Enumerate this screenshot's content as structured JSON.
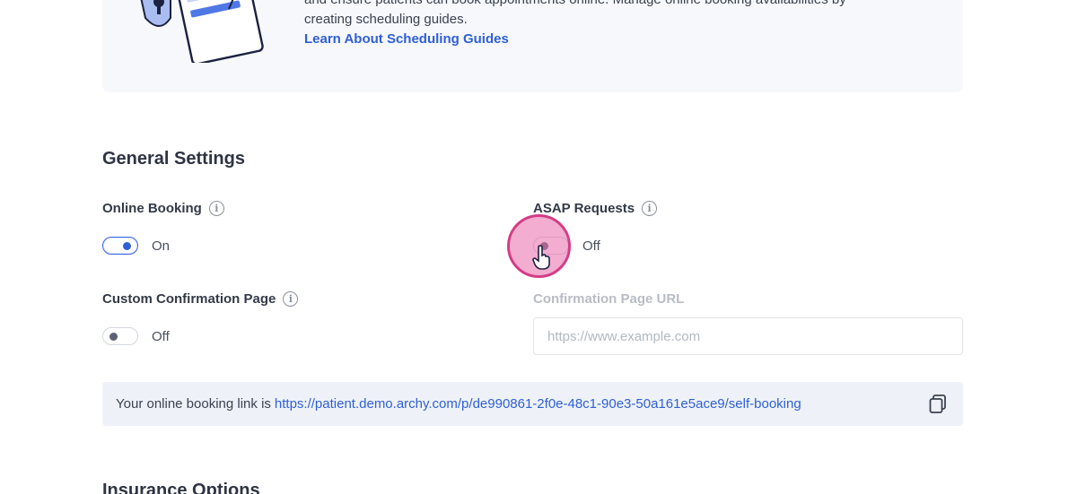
{
  "info_card": {
    "text_line1": "and ensure patients can book appointments online. Manage online booking availabilities by",
    "text_line2": "creating scheduling guides.",
    "link_label": "Learn About Scheduling Guides"
  },
  "general_settings": {
    "title": "General Settings",
    "online_booking": {
      "label": "Online Booking",
      "state": "On",
      "enabled": true
    },
    "asap_requests": {
      "label": "ASAP Requests",
      "state": "Off",
      "enabled": false
    },
    "custom_confirmation": {
      "label": "Custom Confirmation Page",
      "state": "Off",
      "enabled": false
    },
    "confirmation_url": {
      "label": "Confirmation Page URL",
      "placeholder": "https://www.example.com",
      "value": ""
    },
    "booking_link": {
      "prefix": "Your online booking link is",
      "url": "https://patient.demo.archy.com/p/de990861-2f0e-48c1-90e3-50a161e5ace9/self-booking"
    }
  },
  "next_section": {
    "title": "Insurance Options"
  },
  "colors": {
    "accent": "#2f5fd6",
    "cursor_highlight": "#d43d86"
  }
}
